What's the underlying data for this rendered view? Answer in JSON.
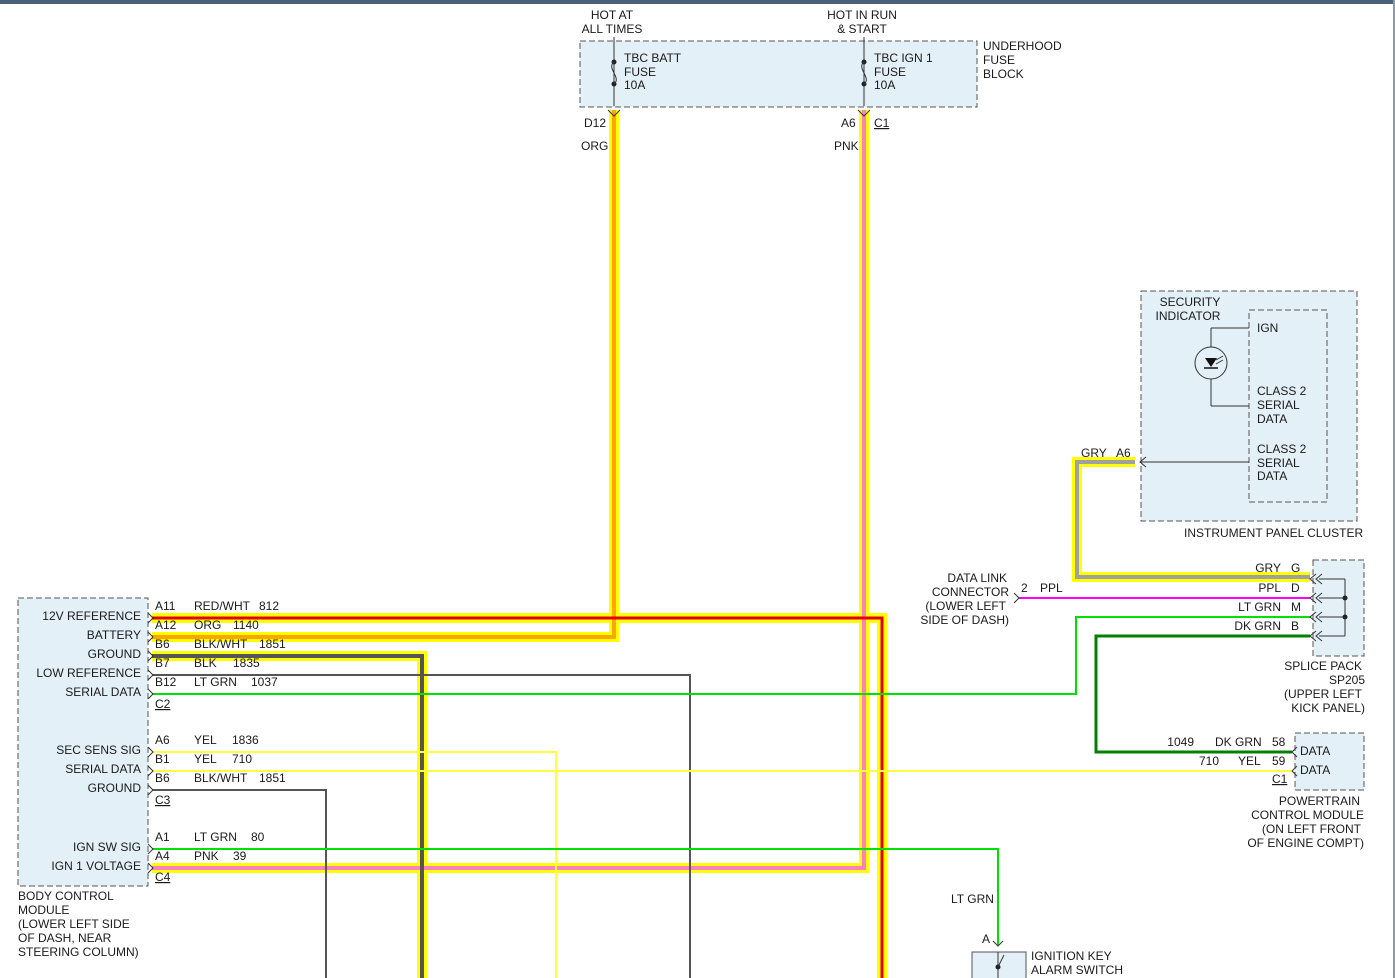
{
  "colors": {
    "highlight": "#ffff00",
    "org": "#ffa500",
    "pnk": "#ff80c0",
    "red": "#e00000",
    "blk": "#555555",
    "ltgrn": "#00e000",
    "dkgrn": "#008000",
    "yel": "#ffff40",
    "gry": "#a0a0a0",
    "ppl": "#ff00ff"
  },
  "fuse_block": {
    "hot_at_1": "HOT AT",
    "hot_at_2": "ALL TIMES",
    "hot_run_1": "HOT IN RUN",
    "hot_run_2": "& START",
    "fuse1": [
      "TBC BATT",
      "FUSE",
      "10A"
    ],
    "fuse2": [
      "TBC IGN 1",
      "FUSE",
      "10A"
    ],
    "label": [
      "UNDERHOOD",
      "FUSE",
      "BLOCK"
    ],
    "pin1": "D12",
    "pin2": "A6",
    "conn": "C1",
    "color1": "ORG",
    "color2": "PNK"
  },
  "ipc": {
    "indicator": [
      "SECURITY",
      "INDICATOR"
    ],
    "ign": "IGN",
    "serial1": [
      "CLASS 2",
      "SERIAL",
      "DATA"
    ],
    "serial2": [
      "CLASS 2",
      "SERIAL",
      "DATA"
    ],
    "label": "INSTRUMENT PANEL CLUSTER",
    "wire_color": "GRY",
    "pin": "A6"
  },
  "dlc": {
    "label": [
      "DATA LINK",
      "CONNECTOR",
      "(LOWER LEFT",
      "SIDE OF DASH)"
    ],
    "pin": "2",
    "color": "PPL"
  },
  "splice": {
    "rows": [
      {
        "color": "GRY",
        "pin": "G"
      },
      {
        "color": "PPL",
        "pin": "D"
      },
      {
        "color": "LT GRN",
        "pin": "M"
      },
      {
        "color": "DK GRN",
        "pin": "B"
      }
    ],
    "label": [
      "SPLICE PACK",
      "SP205",
      "(UPPER LEFT",
      "KICK PANEL)"
    ]
  },
  "pcm": {
    "rows": [
      {
        "circuit": "1049",
        "color": "DK GRN",
        "pin": "58",
        "name": "DATA"
      },
      {
        "circuit": "710",
        "color": "YEL",
        "pin": "59",
        "name": "DATA"
      }
    ],
    "conn": "C1",
    "label": [
      "POWERTRAIN",
      "CONTROL MODULE",
      "(ON LEFT FRONT",
      "OF ENGINE COMPT)"
    ]
  },
  "bcm": {
    "rows": [
      {
        "name": "12V REFERENCE",
        "pin": "A11",
        "color": "RED/WHT",
        "circuit": "812"
      },
      {
        "name": "BATTERY",
        "pin": "A12",
        "color": "ORG",
        "circuit": "1140"
      },
      {
        "name": "GROUND",
        "pin": "B6",
        "color": "BLK/WHT",
        "circuit": "1851"
      },
      {
        "name": "LOW REFERENCE",
        "pin": "B7",
        "color": "BLK",
        "circuit": "1835"
      },
      {
        "name": "SERIAL DATA",
        "pin": "B12",
        "color": "LT GRN",
        "circuit": "1037"
      },
      {
        "name": "SEC SENS SIG",
        "pin": "A6",
        "color": "YEL",
        "circuit": "1836"
      },
      {
        "name": "SERIAL DATA",
        "pin": "B1",
        "color": "YEL",
        "circuit": "710"
      },
      {
        "name": "GROUND",
        "pin": "B6",
        "color": "BLK/WHT",
        "circuit": "1851"
      },
      {
        "name": "IGN SW SIG",
        "pin": "A1",
        "color": "LT GRN",
        "circuit": "80"
      },
      {
        "name": "IGN 1 VOLTAGE",
        "pin": "A4",
        "color": "PNK",
        "circuit": "39"
      }
    ],
    "conn": [
      "C2",
      "C3",
      "C4"
    ],
    "label": [
      "BODY CONTROL",
      "MODULE",
      "(LOWER LEFT SIDE",
      "OF DASH, NEAR",
      "STEERING COLUMN)"
    ]
  },
  "ign_switch": {
    "wire_color": "LT GRN",
    "pin": "A",
    "label": [
      "IGNITION KEY",
      "ALARM SWITCH"
    ]
  }
}
